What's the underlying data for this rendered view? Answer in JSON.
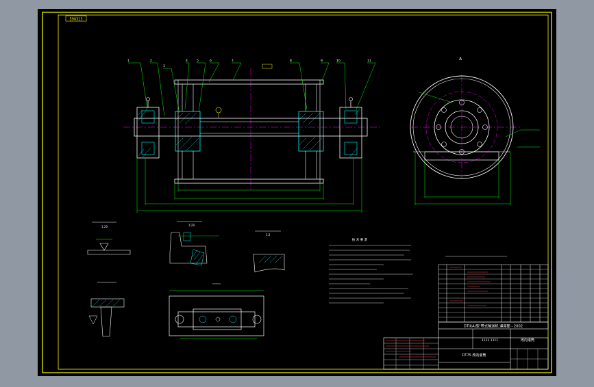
{
  "title_block": {
    "drawing_title": "DTII(A)型 带式输送机 通用图 - 2002",
    "drawing_code": "1111 1111",
    "part_name": "改向滚筒",
    "subtitle": "DT75 改向滚筒",
    "stamp": "590313"
  },
  "notes": {
    "heading": "技 术 要 求"
  },
  "labels": {
    "detail_1": "1:20",
    "detail_2": "1:20",
    "detail_3": "1:2",
    "view_a": "A"
  },
  "colors": {
    "background": "#000000",
    "frame": "#ffff00",
    "line": "#ffffff",
    "leader": "#00ff00",
    "center": "#ff00ff",
    "dim": "#00ffff",
    "hatch": "#00ffff",
    "text": "#ffff00"
  }
}
